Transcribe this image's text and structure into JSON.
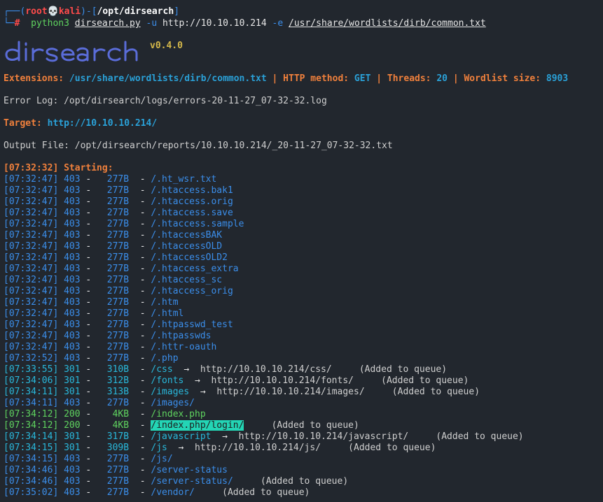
{
  "prompt": {
    "corner_top": "┌──(",
    "user": "root",
    "skull": "💀",
    "host": "kali",
    "sep1": ")-[",
    "path": "/opt/dirsearch",
    "end": "]",
    "corner_bottom": "└─",
    "hash": "#",
    "cmd_prog": "python3",
    "cmd_script": "dirsearch.py",
    "cmd_flag_u": "-u",
    "cmd_url": "http://10.10.10.214",
    "cmd_flag_e": "-e",
    "cmd_wordlist": "/usr/share/wordlists/dirb/common.txt"
  },
  "banner": {
    "version": "v0.4.0"
  },
  "info": {
    "ext_label": "Extensions:",
    "ext_value": "/usr/share/wordlists/dirb/common.txt",
    "method_label": "HTTP method:",
    "method_value": "GET",
    "threads_label": "Threads:",
    "threads_value": "20",
    "wl_label": "Wordlist size:",
    "wl_value": "8903",
    "pipe": "|",
    "error_log": "Error Log: /opt/dirsearch/logs/errors-20-11-27_07-32-32.log",
    "target_label": "Target:",
    "target_value": "http://10.10.10.214/",
    "output_file": "Output File: /opt/dirsearch/reports/10.10.10.214/_20-11-27_07-32-32.txt",
    "starting": "[07:32:32] Starting:"
  },
  "results": [
    {
      "time": "[07:32:47]",
      "code": "403",
      "size": "277B",
      "path": "/.ht_wsr.txt"
    },
    {
      "time": "[07:32:47]",
      "code": "403",
      "size": "277B",
      "path": "/.htaccess.bak1"
    },
    {
      "time": "[07:32:47]",
      "code": "403",
      "size": "277B",
      "path": "/.htaccess.orig"
    },
    {
      "time": "[07:32:47]",
      "code": "403",
      "size": "277B",
      "path": "/.htaccess.save"
    },
    {
      "time": "[07:32:47]",
      "code": "403",
      "size": "277B",
      "path": "/.htaccess.sample"
    },
    {
      "time": "[07:32:47]",
      "code": "403",
      "size": "277B",
      "path": "/.htaccessBAK"
    },
    {
      "time": "[07:32:47]",
      "code": "403",
      "size": "277B",
      "path": "/.htaccessOLD"
    },
    {
      "time": "[07:32:47]",
      "code": "403",
      "size": "277B",
      "path": "/.htaccessOLD2"
    },
    {
      "time": "[07:32:47]",
      "code": "403",
      "size": "277B",
      "path": "/.htaccess_extra"
    },
    {
      "time": "[07:32:47]",
      "code": "403",
      "size": "277B",
      "path": "/.htaccess_sc"
    },
    {
      "time": "[07:32:47]",
      "code": "403",
      "size": "277B",
      "path": "/.htaccess_orig"
    },
    {
      "time": "[07:32:47]",
      "code": "403",
      "size": "277B",
      "path": "/.htm"
    },
    {
      "time": "[07:32:47]",
      "code": "403",
      "size": "277B",
      "path": "/.html"
    },
    {
      "time": "[07:32:47]",
      "code": "403",
      "size": "277B",
      "path": "/.htpasswd_test"
    },
    {
      "time": "[07:32:47]",
      "code": "403",
      "size": "277B",
      "path": "/.htpasswds"
    },
    {
      "time": "[07:32:47]",
      "code": "403",
      "size": "277B",
      "path": "/.httr-oauth"
    },
    {
      "time": "[07:32:52]",
      "code": "403",
      "size": "277B",
      "path": "/.php"
    },
    {
      "time": "[07:33:55]",
      "code": "301",
      "size": "310B",
      "path": "/css",
      "redirect": "http://10.10.10.214/css/",
      "note": "(Added to queue)"
    },
    {
      "time": "[07:34:06]",
      "code": "301",
      "size": "312B",
      "path": "/fonts",
      "redirect": "http://10.10.10.214/fonts/",
      "note": "(Added to queue)"
    },
    {
      "time": "[07:34:11]",
      "code": "301",
      "size": "313B",
      "path": "/images",
      "redirect": "http://10.10.10.214/images/",
      "note": "(Added to queue)"
    },
    {
      "time": "[07:34:11]",
      "code": "403",
      "size": "277B",
      "path": "/images/"
    },
    {
      "time": "[07:34:12]",
      "code": "200",
      "size": "4KB",
      "path": "/index.php"
    },
    {
      "time": "[07:34:12]",
      "code": "200",
      "size": "4KB",
      "path": "/index.php/login/",
      "note": "(Added to queue)",
      "highlight": true
    },
    {
      "time": "[07:34:14]",
      "code": "301",
      "size": "317B",
      "path": "/javascript",
      "redirect": "http://10.10.10.214/javascript/",
      "note": "(Added to queue)"
    },
    {
      "time": "[07:34:15]",
      "code": "301",
      "size": "309B",
      "path": "/js",
      "redirect": "http://10.10.10.214/js/",
      "note": "(Added to queue)"
    },
    {
      "time": "[07:34:15]",
      "code": "403",
      "size": "277B",
      "path": "/js/"
    },
    {
      "time": "[07:34:46]",
      "code": "403",
      "size": "277B",
      "path": "/server-status"
    },
    {
      "time": "[07:34:46]",
      "code": "403",
      "size": "277B",
      "path": "/server-status/",
      "note": "(Added to queue)"
    },
    {
      "time": "[07:35:02]",
      "code": "403",
      "size": "277B",
      "path": "/vendor/",
      "note": "(Added to queue)"
    }
  ],
  "colors": {
    "background": "#22272e",
    "prompt_blue": "#3b8eea",
    "prompt_red": "#ff4b4b",
    "info_orange": "#f0803c",
    "highlight": "#23d5b5"
  }
}
